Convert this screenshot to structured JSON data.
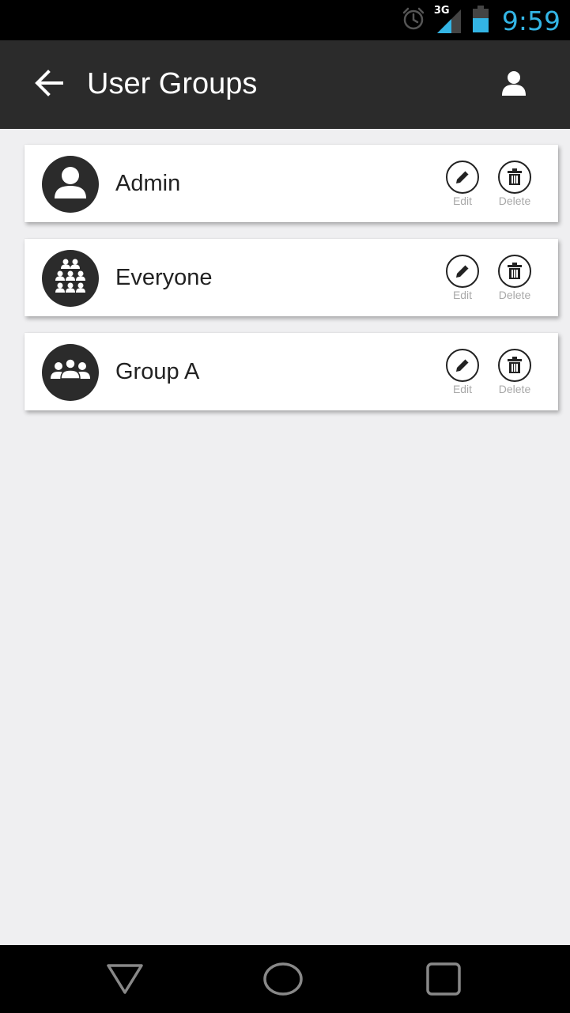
{
  "status_bar": {
    "time": "9:59",
    "network_label": "3G",
    "icons": [
      "alarm-icon",
      "signal-icon",
      "battery-icon"
    ],
    "time_color": "#33b5e5"
  },
  "app_bar": {
    "title": "User Groups",
    "back_icon": "arrow-left-icon",
    "profile_icon": "user-icon",
    "background": "#2b2b2b"
  },
  "groups": [
    {
      "name": "Admin",
      "icon": "single-user-icon",
      "edit_label": "Edit",
      "delete_label": "Delete"
    },
    {
      "name": "Everyone",
      "icon": "crowd-icon",
      "edit_label": "Edit",
      "delete_label": "Delete"
    },
    {
      "name": "Group A",
      "icon": "group-icon",
      "edit_label": "Edit",
      "delete_label": "Delete"
    }
  ],
  "nav_bar": {
    "buttons": [
      "back-triangle-icon",
      "home-circle-icon",
      "recents-square-icon"
    ]
  }
}
